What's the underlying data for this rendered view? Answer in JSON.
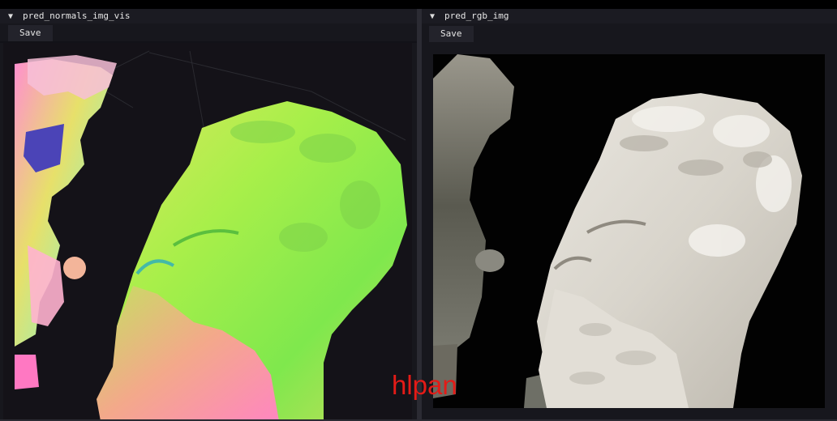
{
  "panels": [
    {
      "title": "pred_normals_img_vis",
      "save_label": "Save",
      "collapse_icon": "triangle-down"
    },
    {
      "title": "pred_rgb_img",
      "save_label": "Save",
      "collapse_icon": "triangle-down"
    }
  ],
  "watermark": "hlpan",
  "colors": {
    "panel_bg": "#17171d",
    "titlebar_bg": "#1b1b22",
    "button_bg": "#23232b",
    "watermark": "#e41b17"
  }
}
